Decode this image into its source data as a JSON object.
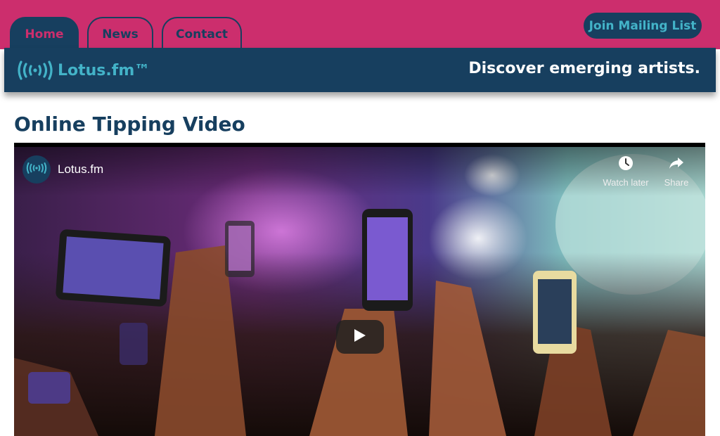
{
  "nav": {
    "tabs": [
      {
        "label": "Home",
        "active": true
      },
      {
        "label": "News",
        "active": false
      },
      {
        "label": "Contact",
        "active": false
      }
    ],
    "join_label": "Join Mailing List"
  },
  "brand": {
    "name": "Lotus.fm™",
    "tagline": "Discover emerging artists.",
    "logo_icon": "radio-waves-icon"
  },
  "section": {
    "title": "Online Tipping Video"
  },
  "video": {
    "channel_name": "Lotus.fm",
    "actions": {
      "watch_later": "Watch later",
      "share": "Share"
    },
    "play_icon": "play-icon"
  },
  "colors": {
    "pink": "#cc2e6d",
    "navy": "#173f5f",
    "teal": "#43b3c8"
  }
}
